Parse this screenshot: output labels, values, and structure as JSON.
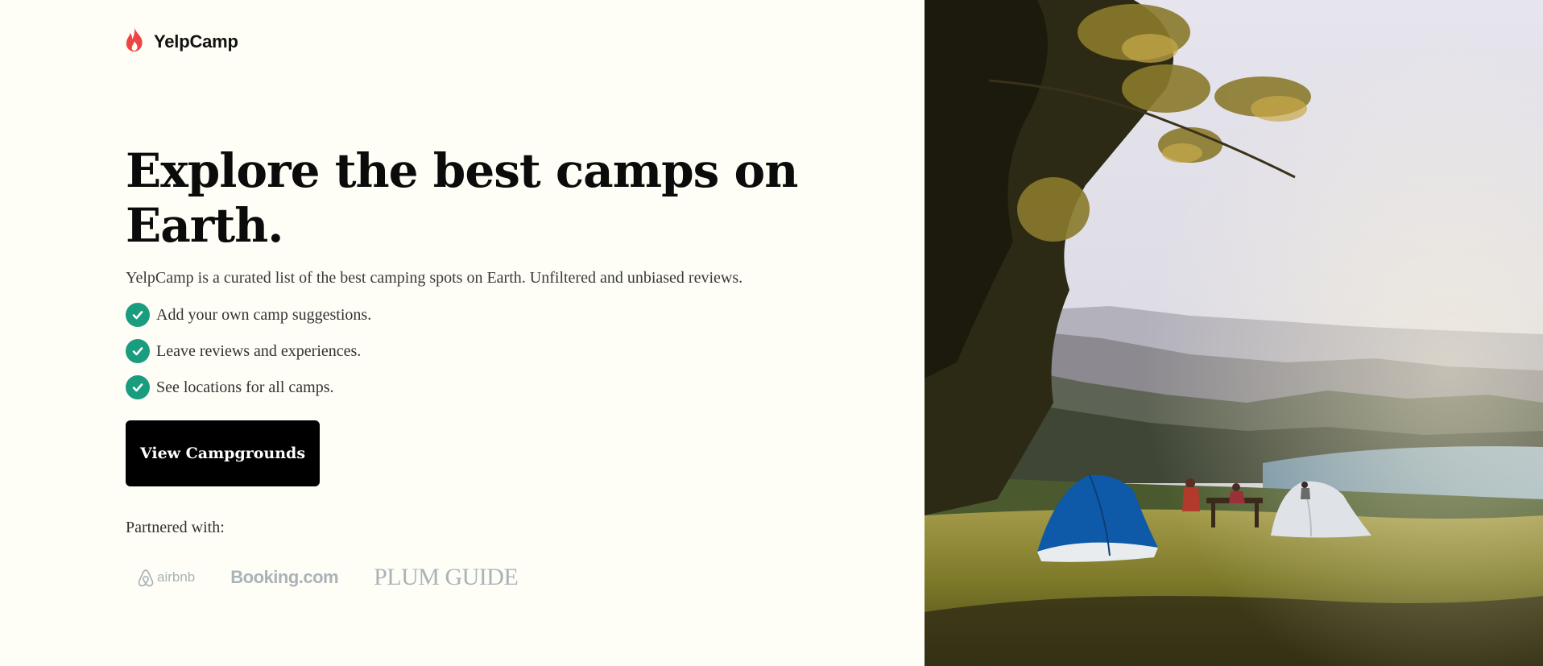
{
  "brand": {
    "name": "YelpCamp",
    "icon": "flame-icon",
    "icon_color": "#ef4444"
  },
  "hero": {
    "title": "Explore the best camps on Earth.",
    "subtitle": "YelpCamp is a curated list of the best camping spots on Earth. Unfiltered and unbiased reviews.",
    "features": [
      "Add your own camp suggestions.",
      "Leave reviews and experiences.",
      "See locations for all camps."
    ],
    "check_color": "#1a9c7e",
    "cta_label": "View Campgrounds"
  },
  "partners": {
    "label": "Partnered with:",
    "logos": [
      {
        "name": "airbnb",
        "icon": "airbnb-logo"
      },
      {
        "name": "Booking.com",
        "icon": "booking-logo"
      },
      {
        "name": "PLUM GUIDE",
        "icon": "plum-guide-logo"
      }
    ]
  },
  "hero_image": {
    "subject": "camping-tents-photo"
  },
  "colors": {
    "background": "#fefef6",
    "text": "#0b0b0b",
    "button": "#000000",
    "partner_logo": "#aab3b8"
  }
}
